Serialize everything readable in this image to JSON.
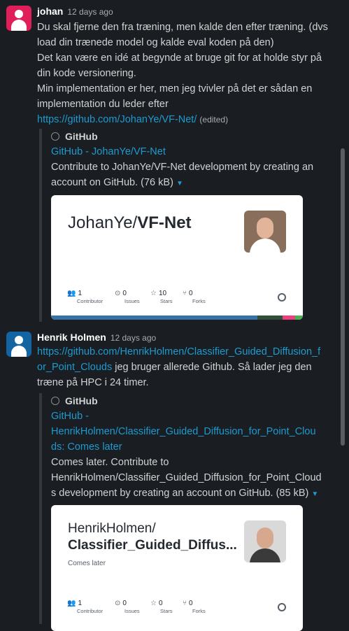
{
  "messages": [
    {
      "author": "johan",
      "time": "12 days ago",
      "lines": [
        "Du skal fjerne den fra træning, men kalde den efter træning. (dvs",
        "load din trænede model og kalde eval koden på den)",
        "Det kan være en idé at begynde at bruge git for at holde styr på",
        "din kode versionering.",
        "Min implementation er her, men jeg tvivler på det er sådan en",
        "implementation du leder efter"
      ],
      "link": "https://github.com/JohanYe/VF-Net/",
      "edited": "(edited)",
      "unfurl": {
        "source": "GitHub",
        "title": "GitHub - JohanYe/VF-Net",
        "desc_lines": [
          "Contribute to JohanYe/VF-Net development by creating an",
          "account on GitHub. (76 kB)"
        ],
        "card": {
          "owner": "JohanYe/",
          "repo": "VF-Net",
          "stats": [
            {
              "value": "1",
              "label": "Contributor"
            },
            {
              "value": "0",
              "label": "Issues"
            },
            {
              "value": "10",
              "label": "Stars"
            },
            {
              "value": "0",
              "label": "Forks"
            }
          ],
          "lang_colors": [
            "#3572A5",
            "#3572A5",
            "#2b7489",
            "#ec407a",
            "#4caf50"
          ]
        }
      }
    },
    {
      "author": "Henrik Holmen",
      "time": "12 days ago",
      "link_lines": [
        "https://github.com/HenrikHolmen/Classifier_Guided_Diffusion_f",
        "or_Point_Clouds"
      ],
      "after_link": " jeg bruger allerede Github. Så lader jeg den",
      "text_line2": "træne på HPC i 24 timer.",
      "unfurl": {
        "source": "GitHub",
        "title_lines": [
          "GitHub -",
          "HenrikHolmen/Classifier_Guided_Diffusion_for_Point_Clou",
          "ds: Comes later"
        ],
        "desc_lines": [
          "Comes later. Contribute to",
          "HenrikHolmen/Classifier_Guided_Diffusion_for_Point_Cloud",
          "s development by creating an account on GitHub. (85 kB)"
        ],
        "card": {
          "owner": "HenrikHolmen/",
          "repo": "Classifier_Guided_Diffus...",
          "subtitle": "Comes later",
          "stats": [
            {
              "value": "1",
              "label": "Contributor"
            },
            {
              "value": "0",
              "label": "Issues"
            },
            {
              "value": "0",
              "label": "Stars"
            },
            {
              "value": "0",
              "label": "Forks"
            }
          ]
        }
      }
    }
  ],
  "colors": {
    "background": "#1a1d21",
    "link": "#1d9bd1",
    "johan_avatar": "#e01e5a",
    "henrik_avatar": "#1264a3"
  },
  "icons": [
    "user-avatar-icon",
    "github-icon",
    "dropdown-caret-icon",
    "contributor-icon",
    "issues-icon",
    "stars-icon",
    "forks-icon"
  ]
}
